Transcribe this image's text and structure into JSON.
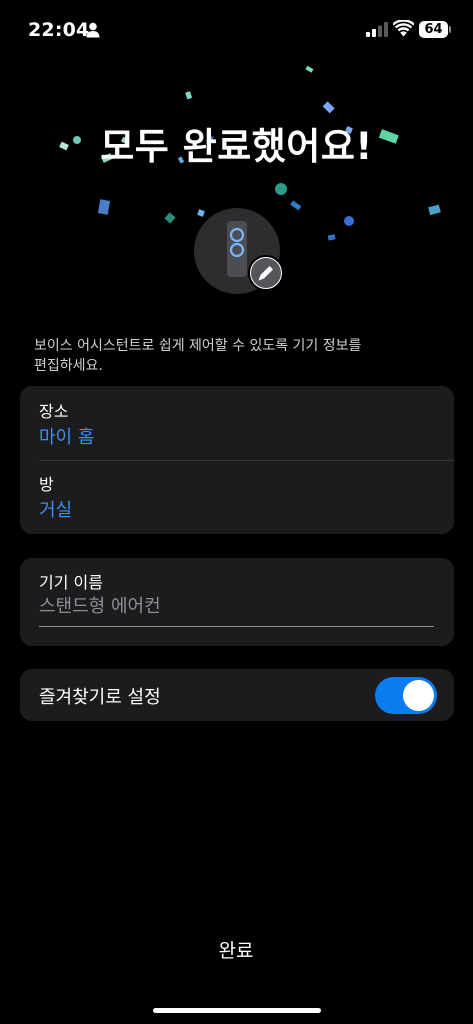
{
  "status_bar": {
    "time": "22:04",
    "battery_level": "64"
  },
  "title": "모두 완료했어요!",
  "description": "보이스 어시스턴트로 쉽게 제어할 수 있도록 기기 정보를 편집하세요.",
  "location_card": {
    "place_label": "장소",
    "place_value": "마이 홈",
    "room_label": "방",
    "room_value": "거실"
  },
  "name_card": {
    "label": "기기 이름",
    "placeholder": "스탠드형 에어컨"
  },
  "favorite": {
    "label": "즐겨찾기로 설정",
    "enabled": true
  },
  "done_label": "완료",
  "colors": {
    "accent": "#3b8ef3",
    "toggle_on": "#0a7cf0",
    "card_bg": "#1c1c1e"
  }
}
